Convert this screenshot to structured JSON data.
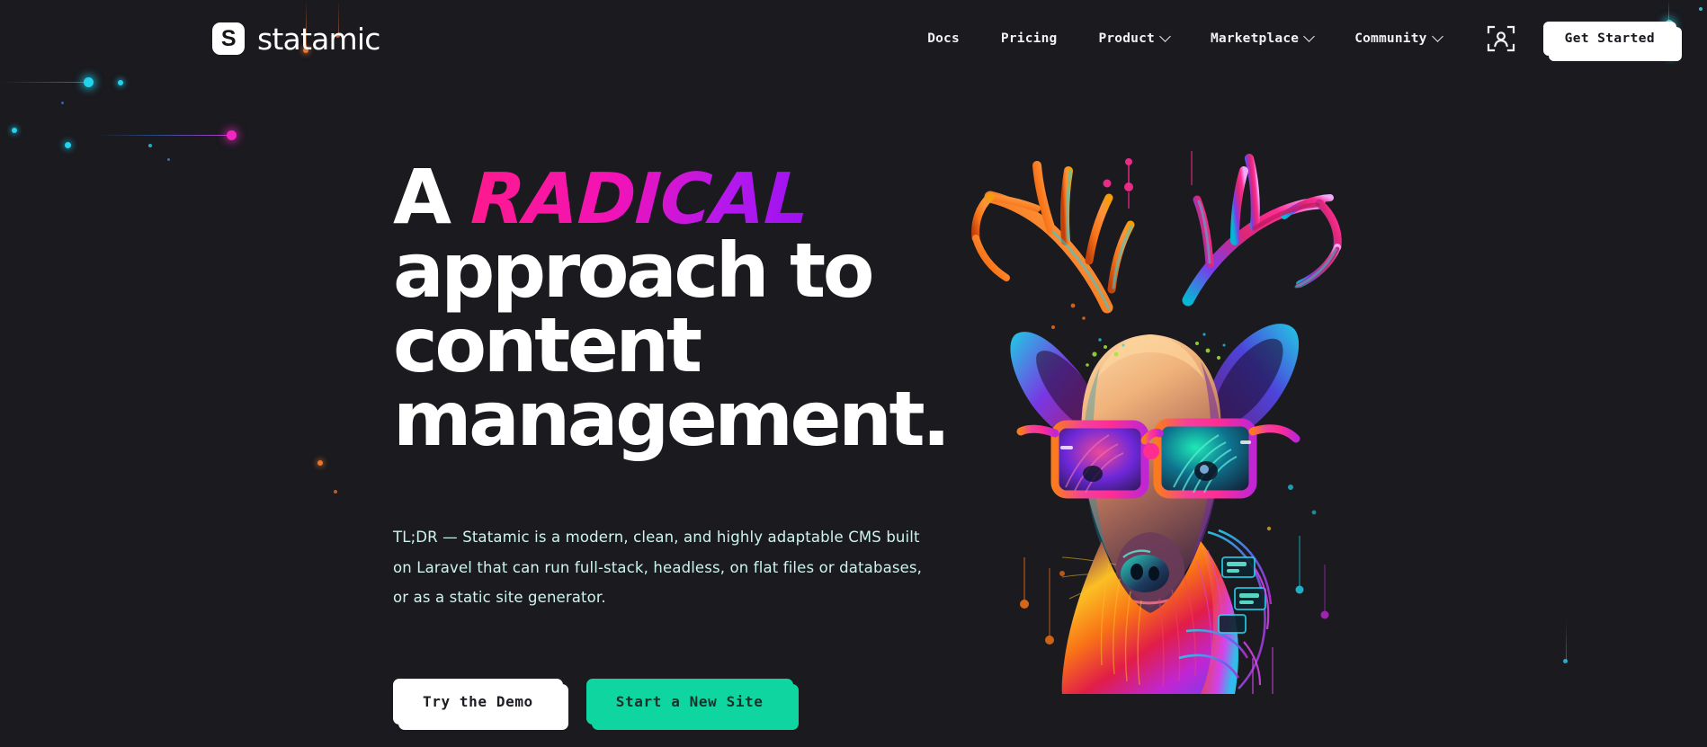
{
  "meta": {
    "background_color": "#1a1a1f",
    "accent_teal": "#0fd6a0",
    "accent_pink": "#ff1a8c",
    "accent_purple": "#9b11f0",
    "text_mint": "#cdf4ec"
  },
  "brand": {
    "mark_letter": "S",
    "name": "statamic"
  },
  "nav": {
    "items": [
      {
        "label": "Docs",
        "has_dropdown": false
      },
      {
        "label": "Pricing",
        "has_dropdown": false
      },
      {
        "label": "Product",
        "has_dropdown": true
      },
      {
        "label": "Marketplace",
        "has_dropdown": true
      },
      {
        "label": "Community",
        "has_dropdown": true
      }
    ],
    "account_icon": "user-scan-icon",
    "cta_label": "Get Started"
  },
  "hero": {
    "headline": {
      "line1_prefix": "A",
      "line1_accent": "RADICAL",
      "line2": "approach to",
      "line3": "content",
      "line4": "management."
    },
    "tldr": "TL;DR —  Statamic is a modern, clean, and highly adaptable CMS built on Laravel that can run full-stack, headless, on flat files or databases, or as a static site generator.",
    "buttons": {
      "secondary": "Try the Demo",
      "primary": "Start a New Site"
    },
    "artwork_alt": "neon deer with sunglasses"
  }
}
